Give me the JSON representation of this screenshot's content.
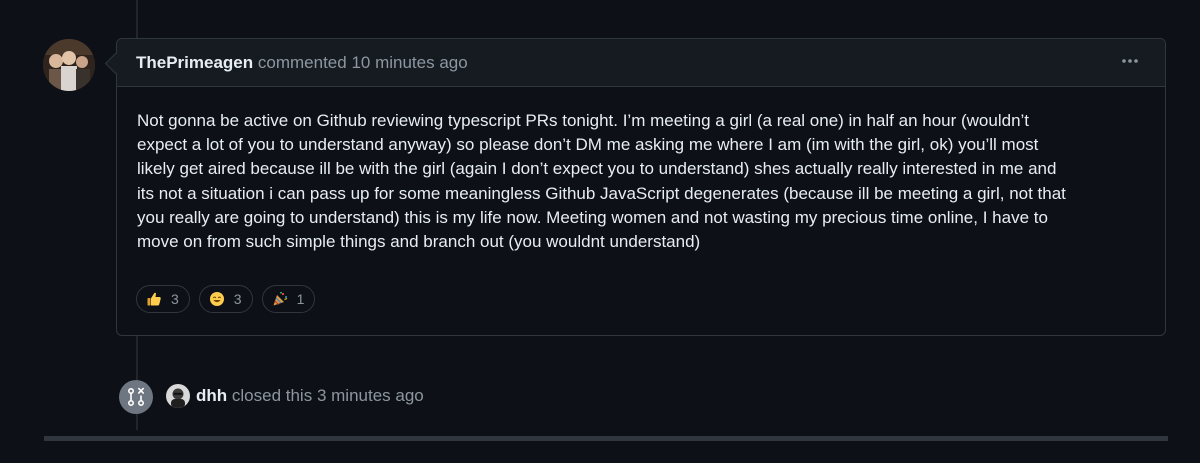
{
  "comment": {
    "author": "ThePrimeagen",
    "action": "commented",
    "time": "10 minutes ago",
    "menu_icon": "kebab-horizontal-icon",
    "body_lines": [
      "Not gonna be active on Github reviewing typescript PRs tonight. I’m meeting a girl (a real one) in half an hour (wouldn’t",
      "expect a lot of you to understand anyway) so please don’t DM me asking me where I am (im with the girl, ok) you’ll most",
      "likely get aired because ill be with the girl (again I don’t expect you to understand) shes actually really interested in me and",
      "its not a situation i can pass up for some meaningless Github JavaScript degenerates (because ill be meeting a girl, not that",
      "you really are going to understand) this is my life now. Meeting women and not wasting my precious time online, I have to",
      "move on from such simple things and branch out (you wouldnt understand)"
    ],
    "reactions": [
      {
        "emoji": "thumbs-up",
        "count": "3"
      },
      {
        "emoji": "smile",
        "count": "3"
      },
      {
        "emoji": "tada",
        "count": "1"
      }
    ]
  },
  "event": {
    "icon": "git-pull-request-closed-icon",
    "actor": "dhh",
    "action": "closed this",
    "time": "3 minutes ago"
  },
  "colors": {
    "background": "#0d1117",
    "header_bg": "#161b22",
    "border": "#30363d",
    "text": "#e6edf3",
    "muted": "#8d96a0",
    "closed_badge": "#6e7681"
  }
}
